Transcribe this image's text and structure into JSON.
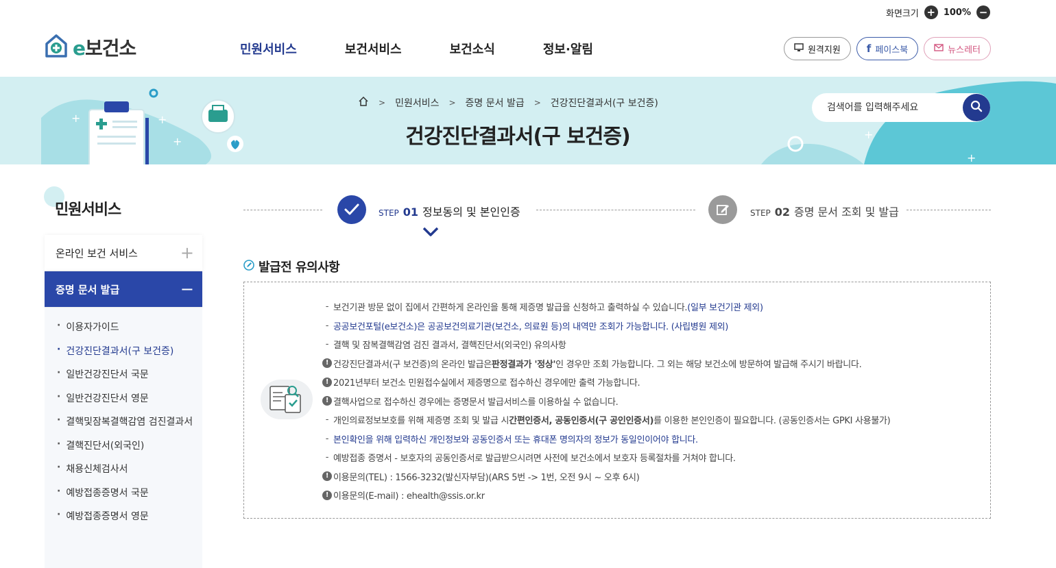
{
  "util": {
    "zoom_label": "화면크기",
    "zoom_in": "+",
    "zoom_value": "100%",
    "zoom_out": "−"
  },
  "header": {
    "logo_e": "e",
    "logo_text": "보건소",
    "nav": [
      "민원서비스",
      "보건서비스",
      "보건소식",
      "정보·알림"
    ],
    "buttons": {
      "remote": "원격지원",
      "facebook": "페이스북",
      "newsletter": "뉴스레터"
    }
  },
  "banner": {
    "breadcrumb": [
      "민원서비스",
      "증명 문서 발급",
      "건강진단결과서(구 보건증)"
    ],
    "title": "건강진단결과서(구 보건증)",
    "search_placeholder": "검색어를 입력해주세요"
  },
  "sidebar": {
    "title": "민원서비스",
    "menu": [
      {
        "label": "온라인 보건 서비스",
        "toggle": "+"
      },
      {
        "label": "증명 문서 발급",
        "toggle": "−"
      }
    ],
    "sub": [
      "이용자가이드",
      "건강진단결과서(구 보건증)",
      "일반건강진단서 국문",
      "일반건강진단서 영문",
      "결핵및잠복결핵감염 검진결과서",
      "결핵진단서(외국인)",
      "채용신체검사서",
      "예방접종증명서 국문",
      "예방접종증명서 영문"
    ]
  },
  "steps": [
    {
      "prefix": "STEP",
      "num": "01",
      "label": "정보동의 및 본인인증"
    },
    {
      "prefix": "STEP",
      "num": "02",
      "label": "증명 문서 조회 및 발급"
    }
  ],
  "notice": {
    "title": "발급전 유의사항",
    "lines": {
      "l1a": "보건기관 방문 없이 집에서 간편하게 온라인을 통해 제증명 발급을 신청하고 출력하실 수 있습니다.",
      "l1b": "(일부 보건기관 제외)",
      "l2": "공공보건포털(e보건소)은 공공보건의료기관(보건소, 의료원 등)의 내역만 조회가 가능합니다. (사립병원 제외)",
      "l3": "결핵 및 잠복결핵감염 검진 결과서, 결핵진단서(외국인) 유의사항",
      "l4a": "건강진단결과서(구 보건증)의 온라인 발급은 ",
      "l4b": "판정결과가 '정상'",
      "l4c": "인 경우만 조회 가능합니다. 그 외는 해당 보건소에 방문하여 발급해 주시기 바랍니다.",
      "l5": "2021년부터 보건소 민원접수실에서 제증명으로 접수하신 경우에만 출력 가능합니다.",
      "l6": "결핵사업으로 접수하신 경우에는 증명문서 발급서비스를 이용하실 수 없습니다.",
      "l7a": "개인의료정보보호를 위해 제증명 조회 및 발급 시 ",
      "l7b": "간편인증서, 공동인증서(구 공인인증서)",
      "l7c": "를 이용한 본인인증이 필요합니다. (공동인증서는 GPKI 사용불가)",
      "l8": "본인확인을 위해 입력하신 개인정보와 공동인증서 또는 휴대폰 명의자의 정보가 동일인이어야 합니다.",
      "l9": "예방접종 증명서 - 보호자의 공동인증서로 발급받으시려면 사전에 보건소에서 보호자 등록절차를 거쳐야 합니다.",
      "l10": "이용문의(TEL) : 1566-3232(발신자부담)(ARS 5번 -> 1번, 오전 9시 ~ 오후 6시)",
      "l11": "이용문의(E-mail) : ehealth@ssis.or.kr"
    }
  },
  "colors": {
    "primary": "#233a8f",
    "banner_bg": "#d3eff2",
    "active_menu": "#2a47a8",
    "teal": "#2a9d8f"
  }
}
